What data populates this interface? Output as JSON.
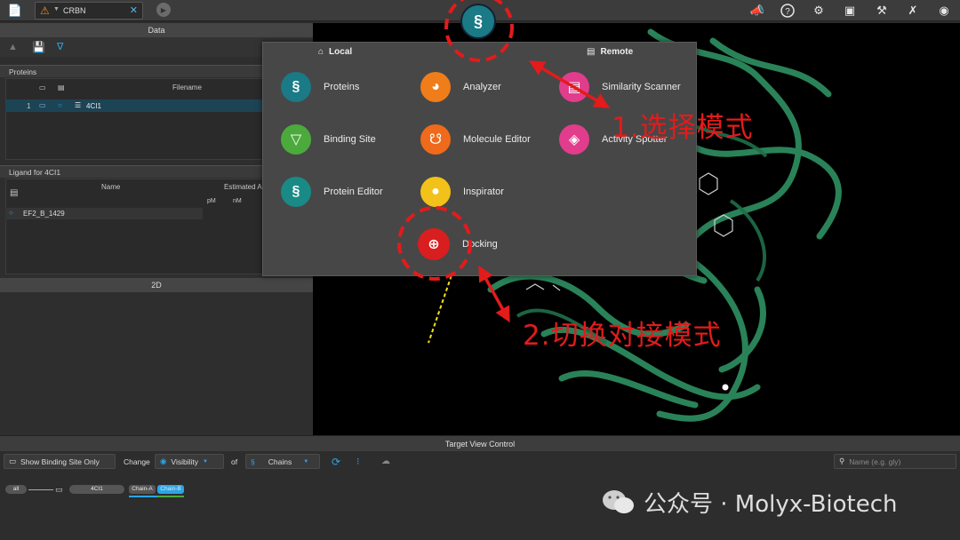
{
  "topbar": {
    "file_tab_name": "CRBN",
    "icons": [
      "document-icon",
      "warning-icon",
      "close-icon",
      "play-icon",
      "announce-icon",
      "help-icon",
      "settings-icon",
      "display-icon",
      "tools-icon",
      "wrench-icon",
      "eye-icon"
    ]
  },
  "left": {
    "data_header": "Data",
    "proteins_label": "Proteins",
    "filename_header": "Filename",
    "protein_rows": [
      {
        "index": "1",
        "name": "4CI1"
      }
    ],
    "ligand_label": "Ligand for 4CI1",
    "ligand_name_header": "Name",
    "ligand_estimated_header": "Estimated A",
    "unit_pm": "pM",
    "unit_nm": "nM",
    "ligand_rows": [
      {
        "name": "EF2_B_1429"
      }
    ],
    "twod_header": "2D"
  },
  "menu": {
    "tab_local": "Local",
    "tab_remote": "Remote",
    "items": [
      {
        "label": "Proteins",
        "color": "#1a7a86",
        "icon": "helix-icon"
      },
      {
        "label": "Analyzer",
        "color": "#ef7d1a",
        "icon": "gauge-icon"
      },
      {
        "label": "Similarity Scanner",
        "color": "#e23c8c",
        "icon": "scan-icon"
      },
      {
        "label": "Binding Site",
        "color": "#4caa3c",
        "icon": "pocket-icon"
      },
      {
        "label": "Molecule Editor",
        "color": "#ef6a1a",
        "icon": "molecule-icon"
      },
      {
        "label": "Activity Spotter",
        "color": "#e23c8c",
        "icon": "spot-icon"
      },
      {
        "label": "Protein Editor",
        "color": "#1a8a86",
        "icon": "helix-edit-icon"
      },
      {
        "label": "Inspirator",
        "color": "#f2c21a",
        "icon": "bulb-icon"
      },
      {
        "label": "Docking",
        "color": "#d81e1e",
        "icon": "docking-icon"
      }
    ]
  },
  "annotations": {
    "step1": "1.选择模式",
    "step2": "2.切换对接模式"
  },
  "tvc": {
    "header": "Target View Control",
    "show_binding_site_only": "Show Binding Site Only",
    "change_label": "Change",
    "visibility_label": "Visibility",
    "of_label": "of",
    "chains_label": "Chains",
    "name_placeholder": "Name (e.g. gly)",
    "tree_all": "all",
    "tree_protein": "4CI1",
    "chain_a": "Chain-A",
    "chain_b": "Chain-B"
  },
  "watermark": "公众号 · Molyx-Biotech",
  "colors": {
    "accent_blue": "#2aa6e8",
    "annotation_red": "#e31b1b",
    "protein_green": "#2d8a5e"
  }
}
